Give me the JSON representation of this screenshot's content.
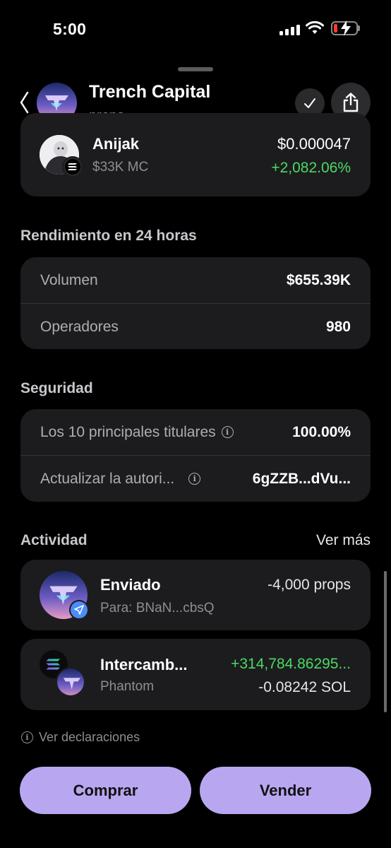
{
  "status_bar": {
    "time": "5:00"
  },
  "header": {
    "title": "Trench Capital",
    "subtitle": "props"
  },
  "token": {
    "name": "Anijak",
    "market_cap": "$33K MC",
    "price": "$0.000047",
    "change": "+2,082.06%"
  },
  "performance": {
    "title": "Rendimiento en 24 horas",
    "rows": [
      {
        "label": "Volumen",
        "value": "$655.39K"
      },
      {
        "label": "Operadores",
        "value": "980"
      }
    ]
  },
  "security": {
    "title": "Seguridad",
    "rows": [
      {
        "label": "Los 10 principales titulares",
        "value": "100.00%"
      },
      {
        "label": "Actualizar la autori...",
        "value": "6gZZB...dVu..."
      }
    ]
  },
  "activity": {
    "title": "Actividad",
    "see_more": "Ver más",
    "items": [
      {
        "title": "Enviado",
        "subtitle": "Para: BNaN...cbsQ",
        "amount": "-4,000 props"
      },
      {
        "title": "Intercamb...",
        "subtitle": "Phantom",
        "amount_in": "+314,784.86295...",
        "amount_out": "-0.08242 SOL"
      }
    ]
  },
  "disclosures": "Ver declaraciones",
  "buttons": {
    "buy": "Comprar",
    "sell": "Vender"
  },
  "colors": {
    "accent": "#b8a7f0",
    "positive": "#4cd964",
    "card": "#1c1c1e"
  },
  "icons": [
    "back-chevron-icon",
    "check-icon",
    "share-icon",
    "info-icon",
    "send-icon",
    "solana-icon"
  ]
}
